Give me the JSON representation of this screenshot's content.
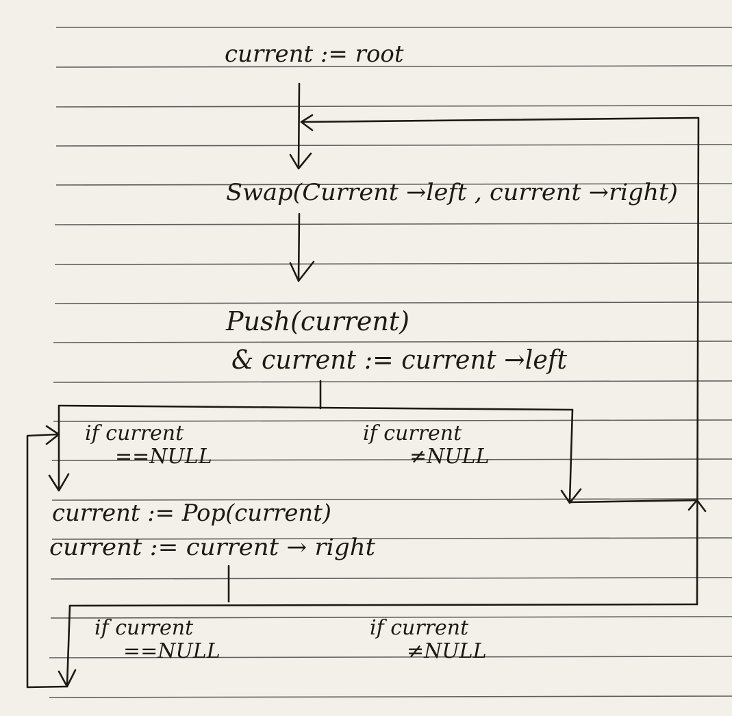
{
  "nodes": {
    "start": "current := root",
    "swap": "Swap(Current →left , current →right)",
    "push_line1": "Push(current)",
    "push_line2": "& current := current →left",
    "branch1": {
      "left_line1": "if current",
      "left_line2": "==NULL",
      "right_line1": "if current",
      "right_line2": "≠NULL"
    },
    "pop_line1": "current := Pop(current)",
    "pop_line2": "current := current → right",
    "branch2": {
      "left_line1": "if current",
      "left_line2": "==NULL",
      "right_line1": "if current",
      "right_line2": "≠NULL"
    }
  },
  "colors": {
    "ink": "#1d1a16",
    "ruled_line": "#5d5d5d",
    "paper": "#f3f0ea"
  }
}
